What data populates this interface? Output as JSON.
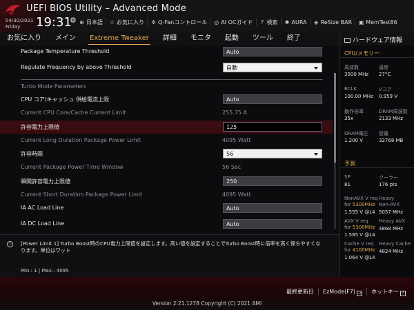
{
  "header": {
    "title": "UEFI BIOS Utility – Advanced Mode",
    "date": "04/30/2021",
    "day": "Friday",
    "time": "19:31",
    "toolbar": [
      {
        "icon": "globe-icon",
        "glyph": "⊕",
        "label": "日本語"
      },
      {
        "icon": "star-icon",
        "glyph": "☆",
        "label": "お気に入り"
      },
      {
        "icon": "fan-icon",
        "glyph": "✲",
        "label": "Q-Fanコントロール"
      },
      {
        "icon": "ai-icon",
        "glyph": "◎",
        "label": "AI OCガイド"
      },
      {
        "icon": "search-icon",
        "glyph": "?",
        "label": "検索"
      },
      {
        "icon": "aura-icon",
        "glyph": "✺",
        "label": "AURA"
      },
      {
        "icon": "resize-bar-icon",
        "glyph": "◈",
        "label": "ReSize BAR"
      },
      {
        "icon": "memtest-icon",
        "glyph": "▣",
        "label": "MemTest86"
      }
    ]
  },
  "nav": {
    "tabs": [
      "お気に入り",
      "メイン",
      "Extreme Tweaker",
      "詳細",
      "モニタ",
      "起動",
      "ツール",
      "終了"
    ],
    "active": "Extreme Tweaker"
  },
  "settings": {
    "pkg_temp": {
      "label": "Package Temperature Threshold",
      "value": "Auto"
    },
    "reg_freq": {
      "label": "Regulate Frequency by above Threshold",
      "value": "自動"
    },
    "section": "Turbo Mode Parameters",
    "cpu_core_limit": {
      "label": "CPU コア/キャッシュ 供給電流上限",
      "value": "Auto"
    },
    "current_core_limit": {
      "label": "Current CPU Core/Cache Current Limit",
      "value": "255.75 A"
    },
    "power_limit": {
      "label": "許容電力上限値",
      "value": "125"
    },
    "current_long": {
      "label": "Current Long Duration Package Power Limit",
      "value": "4095 Watt"
    },
    "time_window": {
      "label": "許容時間",
      "value": "56"
    },
    "current_time_window": {
      "label": "Current Package Power Time Window",
      "value": "56 Sec"
    },
    "short_limit": {
      "label": "瞬間許容電力上限値",
      "value": "250"
    },
    "current_short": {
      "label": "Current Short Duration Package Power Limit",
      "value": "4095 Watt"
    },
    "ia_ac": {
      "label": "IA AC Load Line",
      "value": "Auto"
    },
    "ia_dc": {
      "label": "IA DC Load Line",
      "value": "Auto"
    }
  },
  "help": {
    "text": "[Power Limit 1] Turbo Boost時のCPU電力上限値を設定します。高い値を設定することでTurbo Boost時に倍率を高く保ちやすくなります。単位はワット",
    "minmax": "Min.: 1   |   Max.: 4095"
  },
  "hw": {
    "title": "ハードウェア情報",
    "cpu_section": "CPU/メモリー",
    "freq_label": "周波数",
    "freq": "3500 MHz",
    "temp_label": "温度",
    "temp": "27°C",
    "bclk_label": "BCLK",
    "bclk": "100.00 MHz",
    "vcore_label": "Vコア",
    "vcore": "0.959 V",
    "ratio_label": "動作倍率",
    "ratio": "35x",
    "dram_freq_label": "DRAM周波数",
    "dram_freq": "2133 MHz",
    "dram_v_label": "DRAM電圧",
    "dram_v": "1.200 V",
    "cap_label": "容量",
    "cap": "32768 MB",
    "pred_section": "予測",
    "sp_label": "SP",
    "sp": "81",
    "cooler_label": "クーラー",
    "cooler": "176 pts",
    "nonavx_label": "NonAVX V req",
    "nonavx_for": "for",
    "nonavx_mhz": "5300MHz",
    "nonavx_v": "1.555 V @L4",
    "heavy_nonavx_label": "Heavy",
    "heavy_nonavx_label2": "Non-AVX",
    "heavy_nonavx": "5057 MHz",
    "avx_label": "AVX V req",
    "avx_for": "for",
    "avx_mhz": "5300MHz",
    "avx_v": "1.585 V @L4",
    "heavy_avx_label": "Heavy AVX",
    "heavy_avx": "4868 MHz",
    "cache_label": "Cache V req",
    "cache_for": "for",
    "cache_mhz": "4100MHz",
    "cache_v": "1.064 V @L4",
    "heavy_cache_label": "Heavy Cache",
    "heavy_cache": "4824 MHz"
  },
  "footer": {
    "last_modified": "最終更新日",
    "ezmode": "EzMode(F7)",
    "hotkey": "ホットキー",
    "hotkey_key": "?",
    "version": "Version 2.21.1278 Copyright (C) 2021 AMI"
  }
}
